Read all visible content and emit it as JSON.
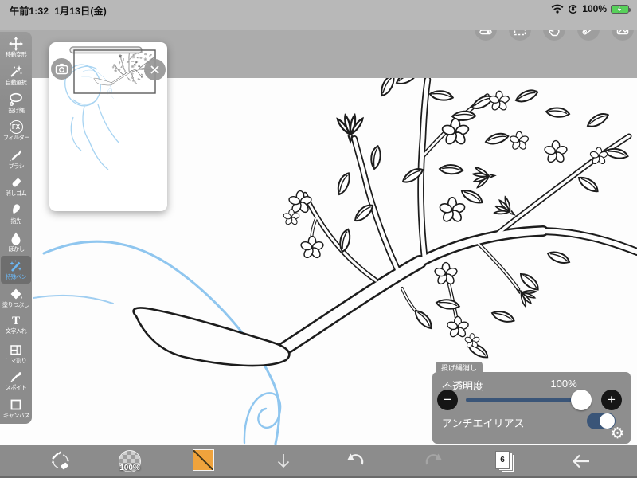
{
  "status_bar": {
    "time": "午前1:32",
    "date": "1月13日(金)",
    "battery_percent": "100%",
    "icons": [
      "wifi-icon",
      "orientation-lock-icon",
      "battery-charging-icon"
    ],
    "battery_color": "#57d15a"
  },
  "top_toolbar": {
    "buttons": [
      {
        "icon": "quick-settings-icon"
      },
      {
        "icon": "selection-icon"
      },
      {
        "icon": "hand-gesture-icon"
      },
      {
        "icon": "ruler-icon"
      },
      {
        "icon": "material-image-icon"
      }
    ]
  },
  "sidebar": {
    "items": [
      {
        "label": "移動変形",
        "icon": "move-transform-icon",
        "selected": false
      },
      {
        "label": "自動選択",
        "icon": "magic-wand-icon",
        "selected": false
      },
      {
        "label": "投げ縄",
        "icon": "lasso-icon",
        "selected": false
      },
      {
        "label": "フィルター",
        "icon": "fx-filter-icon",
        "icon_text": "FX",
        "selected": false
      },
      {
        "label": "ブラシ",
        "icon": "brush-icon",
        "selected": false
      },
      {
        "label": "消しゴム",
        "icon": "eraser-icon",
        "selected": false
      },
      {
        "label": "指先",
        "icon": "finger-icon",
        "selected": false
      },
      {
        "label": "ぼかし",
        "icon": "blur-drop-icon",
        "selected": false
      },
      {
        "label": "特殊ペン",
        "icon": "special-pen-icon",
        "selected": true
      },
      {
        "label": "塗りつぶし",
        "icon": "fill-bucket-icon",
        "selected": false
      },
      {
        "label": "文字入れ",
        "icon": "text-tool-icon",
        "icon_text": "T",
        "selected": false
      },
      {
        "label": "コマ割り",
        "icon": "panel-divide-icon",
        "selected": false
      },
      {
        "label": "スポイト",
        "icon": "eyedropper-icon",
        "selected": false
      },
      {
        "label": "キャンバス",
        "icon": "canvas-icon",
        "selected": false
      }
    ],
    "selected_color": "#6cb8f5"
  },
  "navigator": {
    "buttons": [
      {
        "icon": "camera-icon"
      },
      {
        "icon": "close-icon",
        "glyph": "✕"
      }
    ]
  },
  "tool_panel": {
    "tab": "投げ縄消し",
    "opacity_label": "不透明度",
    "opacity_value": "100%",
    "minus_glyph": "−",
    "plus_glyph": "+",
    "antialias_label": "アンチエイリアス",
    "antialias_on": true,
    "gear_glyph": "⚙",
    "accent_color": "#3a5578"
  },
  "bottom_toolbar": {
    "brush_size": "100%",
    "layers_count": "6",
    "swatch_color": "#f0a33c",
    "items": [
      "pen-eraser-swap-icon",
      "brush-size-preview",
      "color-swatch",
      "down-arrow-icon",
      "undo-icon",
      "redo-icon",
      "layers-icon",
      "back-arrow-icon"
    ]
  },
  "canvas": {
    "content": "line drawing of a flowering branch with light blue rough sketch strokes",
    "line_color": "#1c1c1c",
    "sketch_color": "#8fc6ef"
  }
}
